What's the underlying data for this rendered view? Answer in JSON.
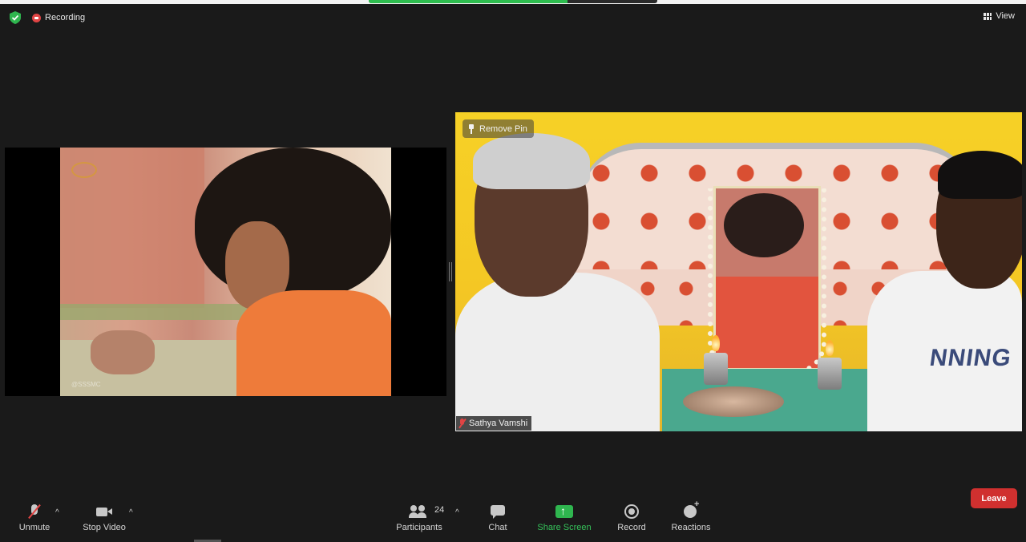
{
  "window": {
    "sharing_bar_progress": 0.69
  },
  "status": {
    "encryption_icon": "shield-check-icon",
    "recording_label": "Recording",
    "recording_color": "#e04444"
  },
  "view": {
    "label": "View",
    "icon": "grid-icon"
  },
  "tiles": {
    "left": {
      "type": "shared-video",
      "watermark": "@SSSMC"
    },
    "right": {
      "pin_label": "Remove Pin",
      "pin_icon": "pin-icon",
      "participant_name": "Sathya Vamshi",
      "muted": true,
      "shirt_text": "NNING"
    }
  },
  "toolbar": {
    "unmute_label": "Unmute",
    "stop_video_label": "Stop Video",
    "participants_label": "Participants",
    "participants_count": "24",
    "chat_label": "Chat",
    "share_screen_label": "Share Screen",
    "share_screen_color": "#35c35a",
    "record_label": "Record",
    "reactions_label": "Reactions",
    "leave_label": "Leave",
    "leave_color": "#d0302f",
    "caret": "^"
  }
}
